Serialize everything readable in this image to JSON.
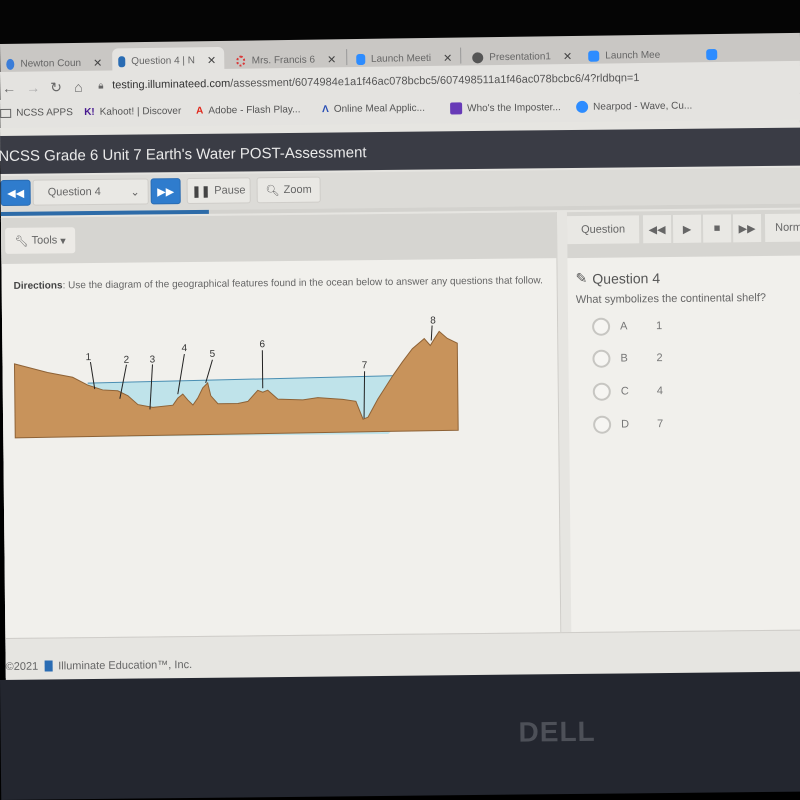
{
  "browser": {
    "tabs": [
      {
        "label": "Newton Coun",
        "icon": "cloud-icon",
        "color": "#3b7dd8",
        "active": false
      },
      {
        "label": "Question 4 | N",
        "icon": "illuminate-icon",
        "color": "#2a6cb3",
        "active": true
      },
      {
        "label": "Mrs. Francis 6",
        "icon": "circle-dotted-icon",
        "color": "#d83a3a",
        "active": false
      },
      {
        "label": "Launch Meeti",
        "icon": "zoom-icon",
        "color": "#2d8cff",
        "active": false
      },
      {
        "label": "Presentation1",
        "icon": "globe-icon",
        "color": "#555555",
        "active": false
      },
      {
        "label": "Launch Mee",
        "icon": "zoom-icon",
        "color": "#2d8cff",
        "active": false
      }
    ],
    "url_host": "testing.illuminateed.com",
    "url_path": "/assessment/6074984e1a1f46ac078bcbc5/607498511a1f46ac078bcbc6/4?rldbqn=1",
    "bookmarks": [
      {
        "label": "NCSS APPS",
        "icon": "folder-icon"
      },
      {
        "label": "Kahoot! | Discover",
        "icon": "kahoot-icon"
      },
      {
        "label": "Adobe - Flash Play...",
        "icon": "adobe-icon"
      },
      {
        "label": "Online Meal Applic...",
        "icon": "meal-app-icon"
      },
      {
        "label": "Who's the Imposter...",
        "icon": "forms-icon"
      },
      {
        "label": "Nearpod - Wave, Cu...",
        "icon": "nearpod-icon"
      }
    ]
  },
  "app": {
    "title": "NCSS Grade 6 Unit 7 Earth's Water POST-Assessment",
    "toolbar": {
      "question_select": "Question 4",
      "pause_label": "Pause",
      "zoom_label": "Zoom"
    },
    "progress_percent": 26,
    "tools_label": "Tools",
    "directions_label": "Directions",
    "directions_text": ": Use the diagram of the geographical features found in the ocean below to answer any questions that follow.",
    "diagram_labels": [
      "1",
      "2",
      "3",
      "4",
      "5",
      "6",
      "7",
      "8"
    ],
    "right_toolbar": {
      "question_label": "Question",
      "speed_label": "Norm"
    },
    "question": {
      "title": "Question 4",
      "text": "What symbolizes the continental shelf?",
      "choices": [
        {
          "letter": "A",
          "value": "1"
        },
        {
          "letter": "B",
          "value": "2"
        },
        {
          "letter": "C",
          "value": "4"
        },
        {
          "letter": "D",
          "value": "7"
        }
      ]
    },
    "footer": "©2021",
    "footer_company": "Illuminate Education™, Inc."
  },
  "device": {
    "brand": "DELL"
  },
  "colors": {
    "accent": "#2f7ccd",
    "title_bar": "#3a3c45",
    "land": "#c8935b",
    "water": "#bfe3ea"
  }
}
